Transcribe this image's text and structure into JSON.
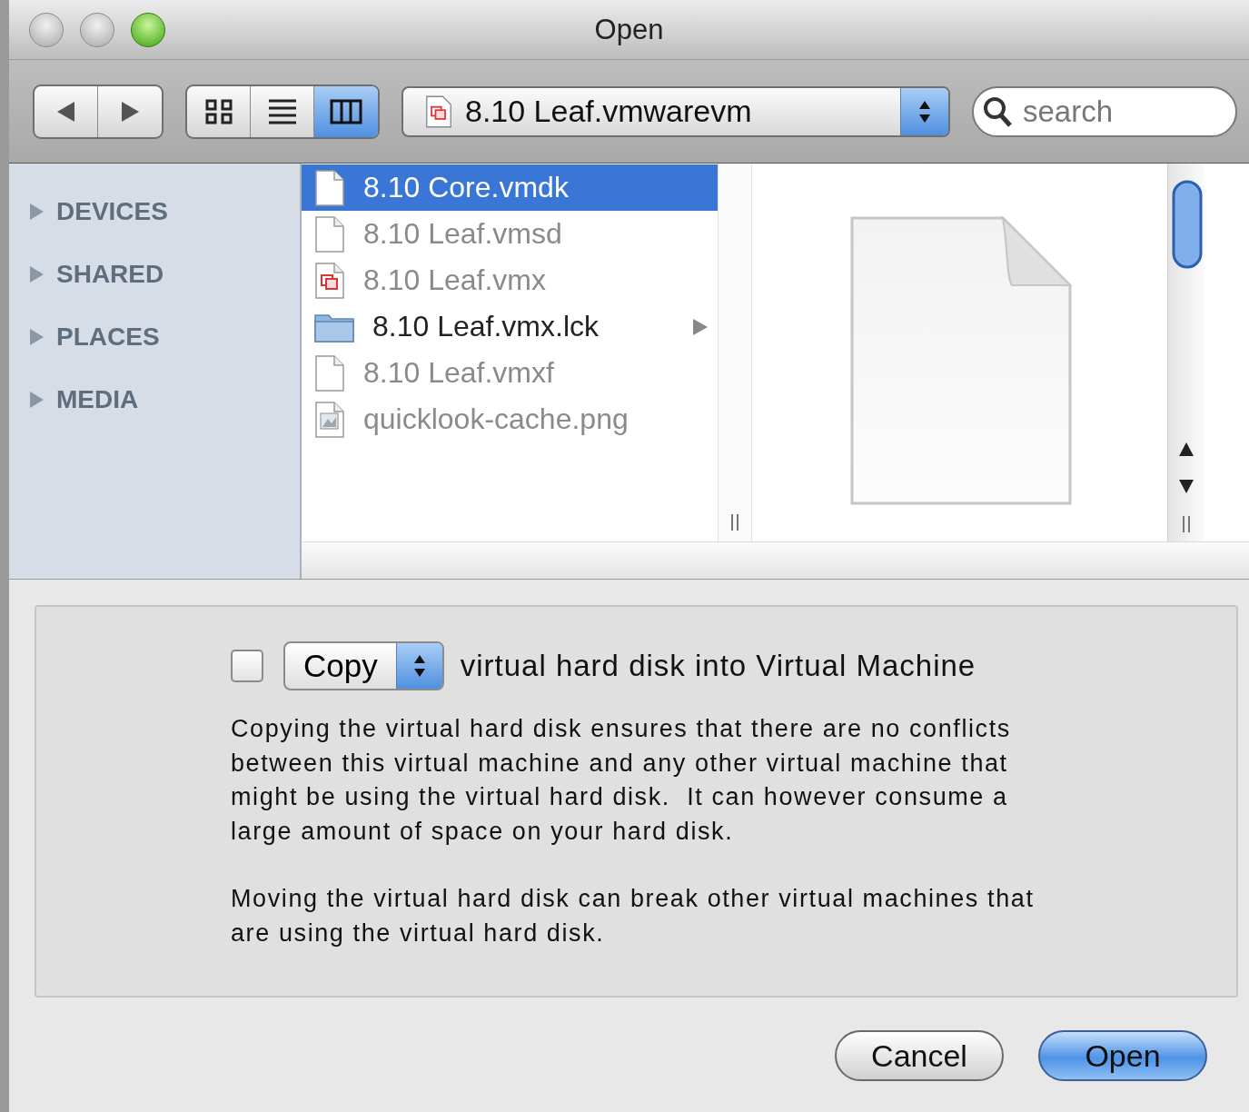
{
  "window": {
    "title": "Open"
  },
  "toolbar": {
    "views": [
      {
        "kind": "icon",
        "selected": false
      },
      {
        "kind": "list",
        "selected": false
      },
      {
        "kind": "column",
        "selected": true
      }
    ],
    "path": {
      "label": "8.10 Leaf.vmwarevm"
    },
    "search": {
      "placeholder": "search"
    }
  },
  "sidebar": {
    "sections": [
      {
        "label": "DEVICES",
        "expanded": false
      },
      {
        "label": "SHARED",
        "expanded": false
      },
      {
        "label": "PLACES",
        "expanded": false
      },
      {
        "label": "MEDIA",
        "expanded": false
      }
    ]
  },
  "files": [
    {
      "name": "8.10 Core.vmdk",
      "kind": "document",
      "selected": true,
      "disabled": false
    },
    {
      "name": "8.10 Leaf.vmsd",
      "kind": "document",
      "selected": false,
      "disabled": true
    },
    {
      "name": "8.10 Leaf.vmx",
      "kind": "vm",
      "selected": false,
      "disabled": true
    },
    {
      "name": "8.10 Leaf.vmx.lck",
      "kind": "folder",
      "selected": false,
      "disabled": false
    },
    {
      "name": "8.10 Leaf.vmxf",
      "kind": "document",
      "selected": false,
      "disabled": true
    },
    {
      "name": "quicklook-cache.png",
      "kind": "image",
      "selected": false,
      "disabled": true
    }
  ],
  "options": {
    "checked": false,
    "action": "Copy",
    "label": "virtual hard disk into Virtual Machine",
    "paragraphs": [
      "Copying the virtual hard disk ensures that there are no conflicts between this virtual machine and any other virtual machine that might be using the virtual hard disk.  It can however consume a large amount of space on your hard disk.",
      "Moving the virtual hard disk can break other virtual machines that are using the virtual hard disk."
    ]
  },
  "buttons": [
    {
      "label": "Cancel",
      "default": false
    },
    {
      "label": "Open",
      "default": true
    }
  ]
}
